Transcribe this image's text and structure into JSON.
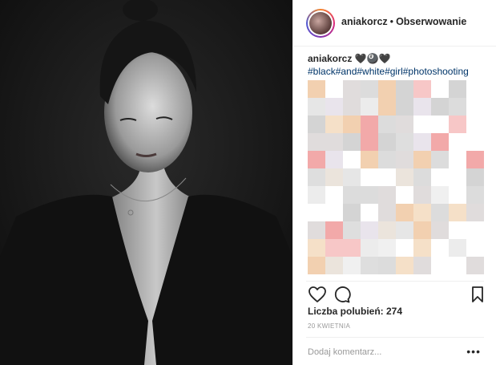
{
  "post": {
    "photo_alt": "",
    "username": "aniakorcz",
    "separator": "•",
    "follow_label": "Obserwowanie",
    "caption_user": "aniakorcz",
    "caption_emoji": "🖤🎱🖤",
    "hashtags": "#black#and#white#girl#photoshooting",
    "likes_text": "Liczba polubień: 274",
    "date": "20 KWIETNIA",
    "comment_placeholder": "Dodaj komentarz...",
    "more_label": "•••"
  },
  "icons": {
    "like": "heart-icon",
    "comment": "comment-icon",
    "save": "bookmark-icon",
    "more": "more-options-icon"
  },
  "colors": {
    "hashtag": "#003569",
    "text": "#262626",
    "muted": "#999999",
    "border": "#efefef"
  }
}
